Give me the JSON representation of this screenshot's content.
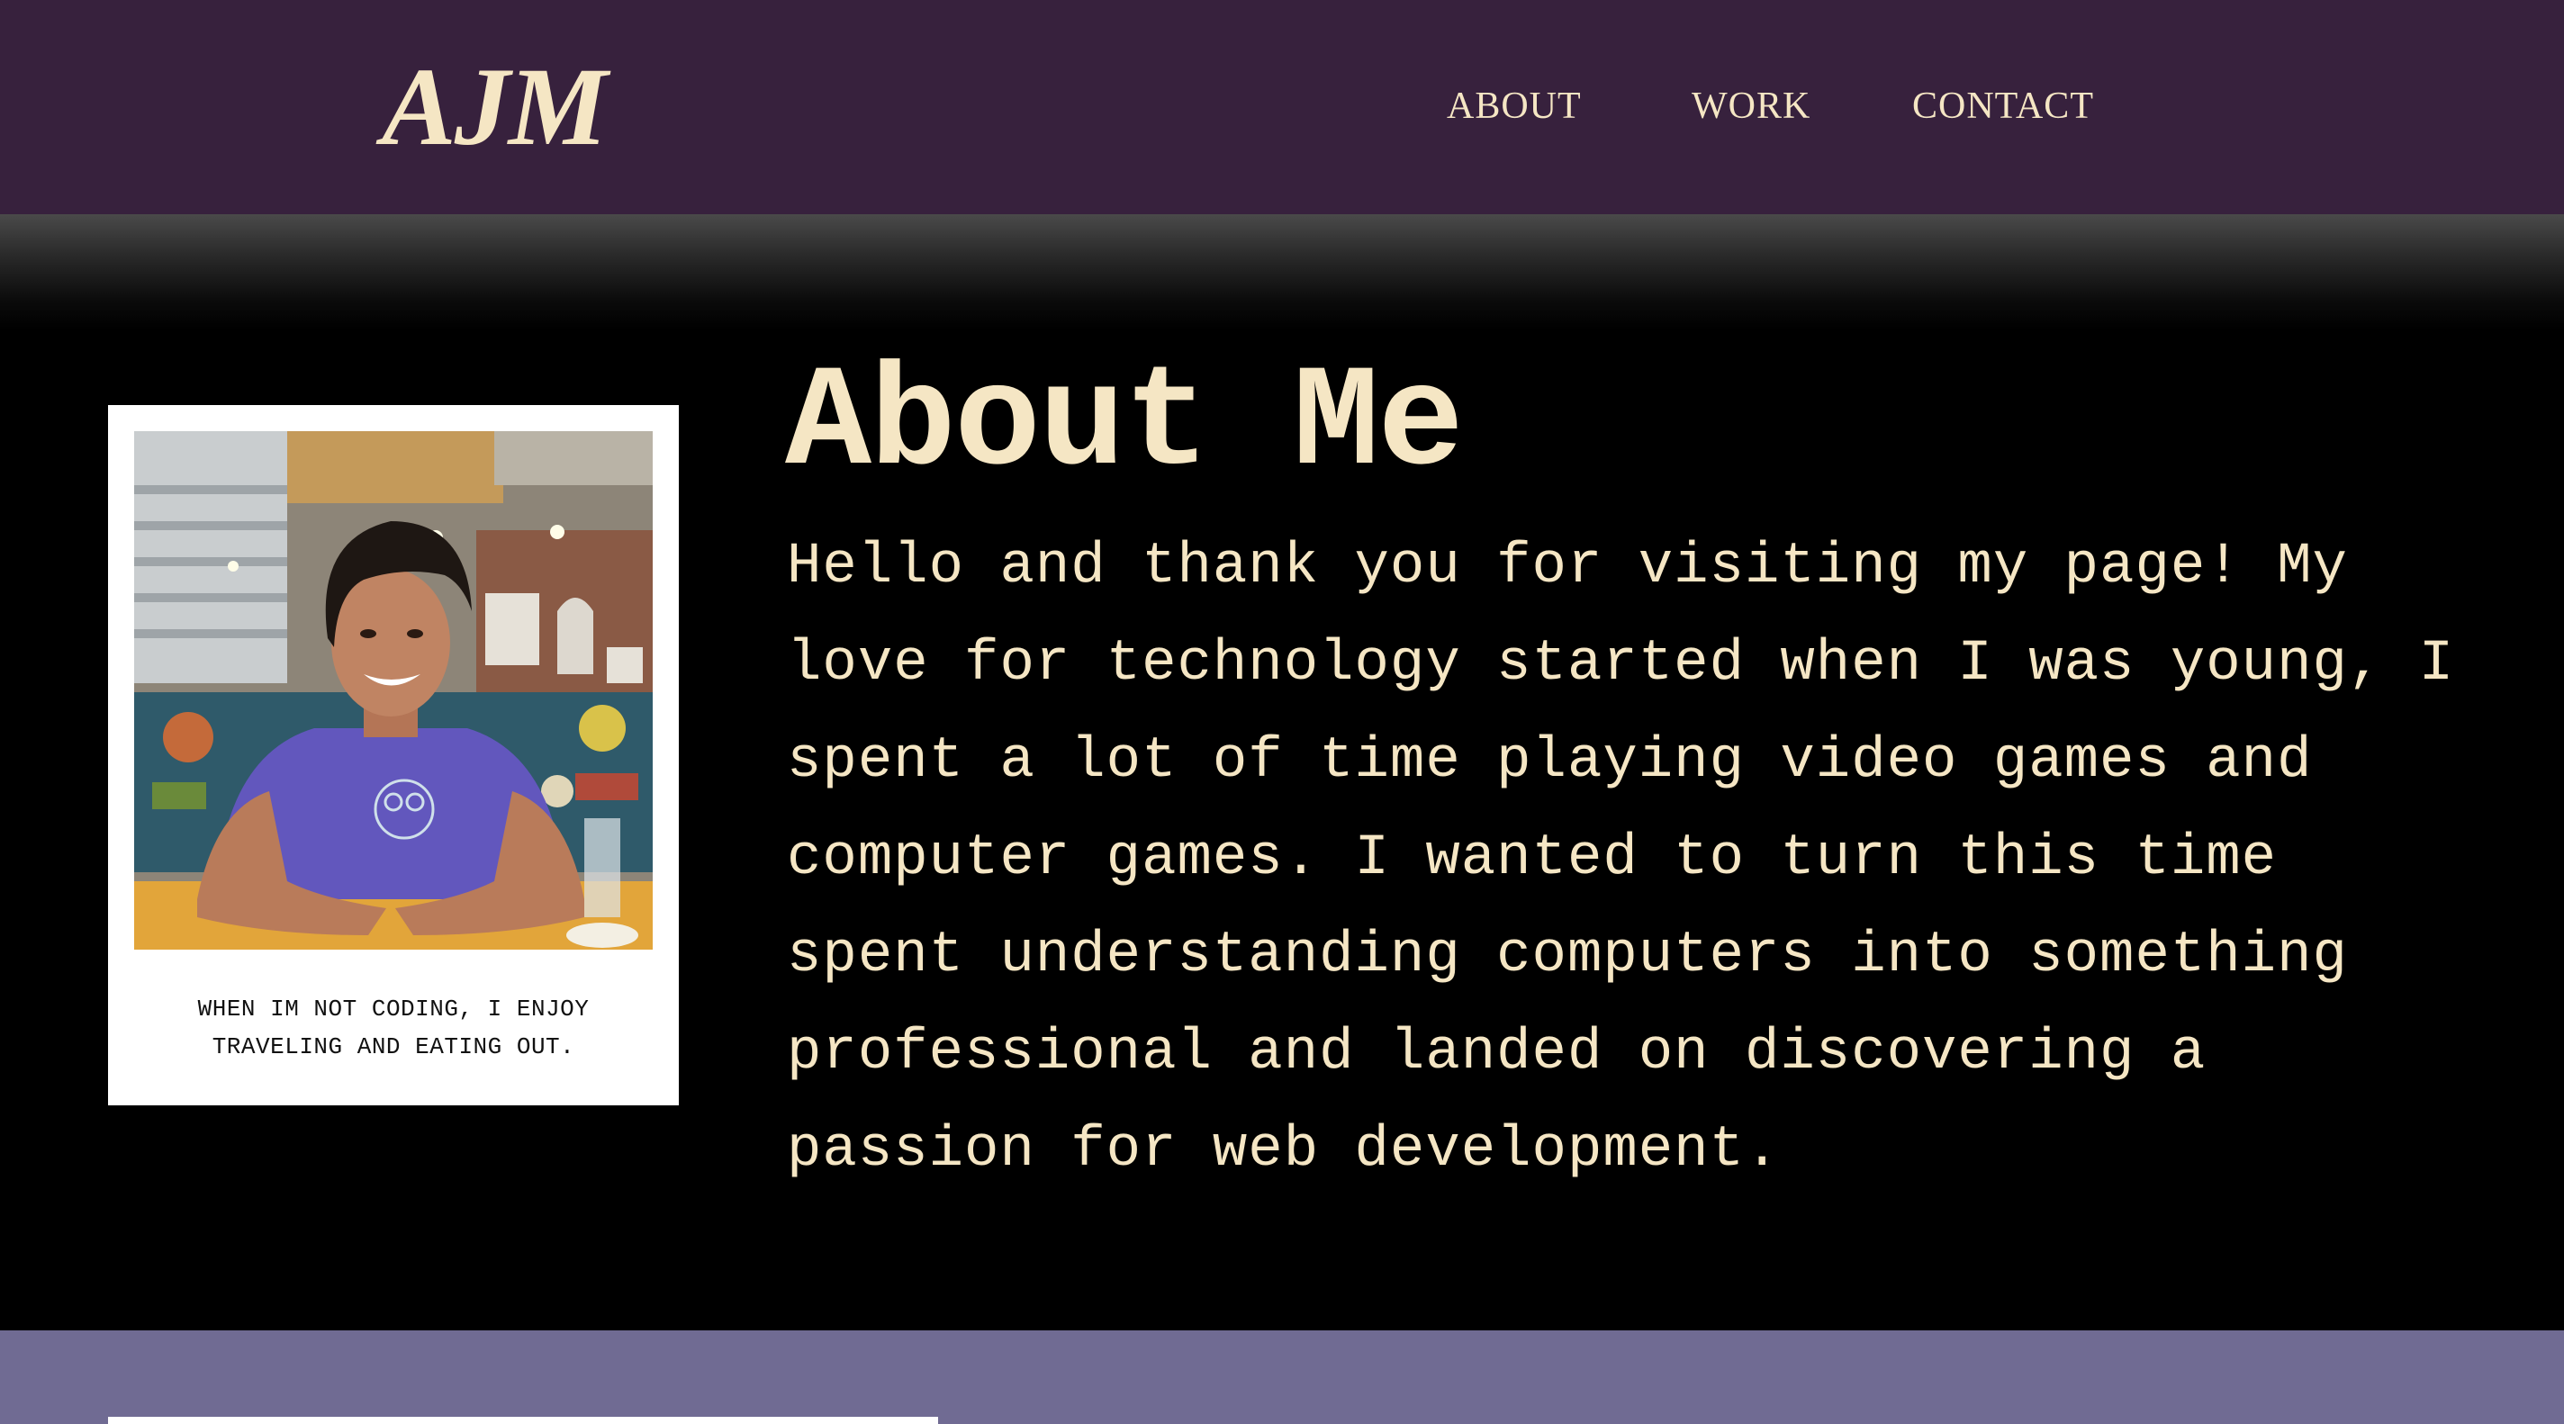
{
  "header": {
    "logo": "AJM",
    "nav": {
      "about": "ABOUT",
      "work": "WORK",
      "contact": "CONTACT"
    }
  },
  "about": {
    "title": "About Me",
    "body": "Hello and thank you for visiting my page! My love for technology started when I was young, I spent a lot of time playing video games and computer games. I wanted to turn this time spent understanding computers into something professional and landed on discovering a passion for web development.",
    "photo_caption_line1": "WHEN IM NOT CODING, I ENJOY",
    "photo_caption_line2": "TRAVELING AND EATING OUT.",
    "photo_icon": "profile-photo"
  },
  "colors": {
    "header_bg": "#37213d",
    "accent_text": "#f5e6c4",
    "page_bg": "#000000",
    "next_section_bg": "#706b93"
  }
}
